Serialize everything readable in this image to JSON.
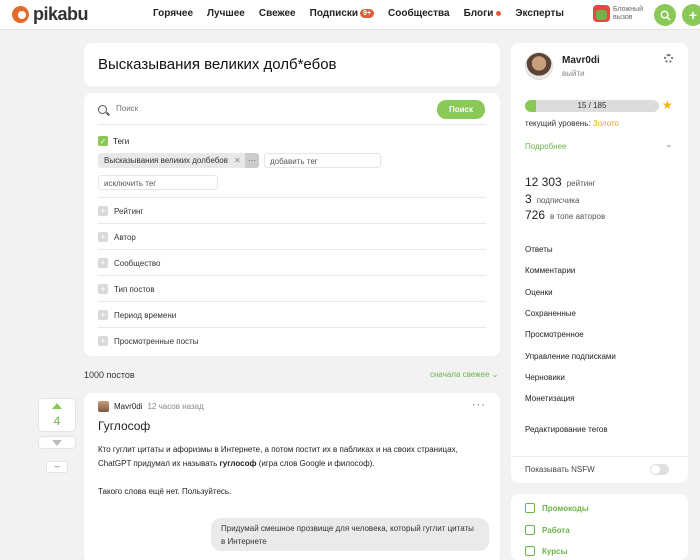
{
  "header": {
    "logo": "pikabu",
    "nav": [
      {
        "label": "Горячее"
      },
      {
        "label": "Лучшее"
      },
      {
        "label": "Свежее"
      },
      {
        "label": "Подписки",
        "badge": "9+"
      },
      {
        "label": "Сообщества"
      },
      {
        "label": "Блоги",
        "dot": true
      },
      {
        "label": "Эксперты"
      }
    ],
    "challenge_line1": "Бложный",
    "challenge_line2": "вызов",
    "search_icon": "search-icon",
    "add_icon": "plus-icon"
  },
  "page": {
    "title": "Высказывания великих долб*ебов"
  },
  "filters": {
    "search_placeholder": "Поиск",
    "search_button": "Поиск",
    "tags_label": "Теги",
    "tag_chip": "Высказывания великих долбебов",
    "tag_chip_more": "···",
    "add_tag_placeholder": "добавить тег",
    "exclude_tag_placeholder": "исключить тег",
    "items": [
      "Рейтинг",
      "Автор",
      "Сообщество",
      "Тип постов",
      "Период времени",
      "Просмотренные посты"
    ]
  },
  "listing": {
    "count": "1000 постов",
    "sort": "сначала свежее"
  },
  "post": {
    "rating": "4",
    "author": "Mavr0di",
    "time": "12 часов назад",
    "menu": "···",
    "title": "Гуглософ",
    "text_1a": "Кто гуглит цитаты и афоризмы в Интернете, а потом постит их в пабликах и на своих страницах, ChatGPT придумал их называть ",
    "text_1b": "гуглософ",
    "text_1c": " (игра слов Google и философ).",
    "text_2": "Такого слова ещё нет. Пользуйтесь.",
    "bubble": "Придумай смешное прозвище для человека, который гуглит цитаты в Интернете",
    "minus": "–"
  },
  "profile": {
    "name": "Mavr0di",
    "logout": "выйти",
    "progress_text": "15 / 185",
    "progress_value": 0.081,
    "level_label": "текущий уровень:",
    "level_value": "Золото",
    "more": "Подробнее",
    "stats": [
      {
        "num": "12 303",
        "label": "рейтинг"
      },
      {
        "num": "3",
        "label": "подписчика"
      },
      {
        "num": "726",
        "label": "в топе авторов"
      }
    ],
    "menu": [
      "Ответы",
      "Комментарии",
      "Оценки",
      "Сохраненные",
      "Просмотренное",
      "Управление подписками",
      "Черновики",
      "Монетизация"
    ],
    "edit_tags": "Редактирование тегов",
    "nsfw": "Показывать NSFW"
  },
  "links": [
    {
      "label": "Промокоды",
      "icon": "tag-icon"
    },
    {
      "label": "Работа",
      "icon": "briefcase-icon"
    },
    {
      "label": "Курсы",
      "icon": "graduation-icon"
    }
  ],
  "colors": {
    "accent": "#8ac858",
    "link": "#6bb54a",
    "badge": "#e25b3c",
    "gold": "#e6a817"
  }
}
